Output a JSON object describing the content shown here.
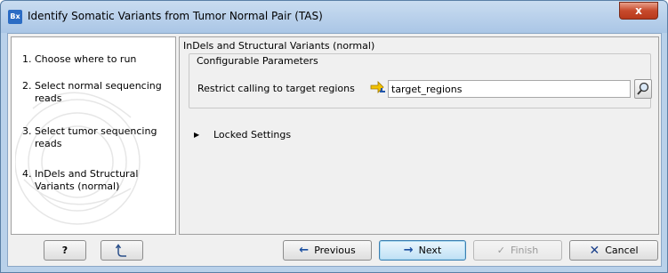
{
  "window": {
    "app_icon_text": "Bx",
    "title": "Identify Somatic Variants from Tumor Normal Pair (TAS)",
    "close_label": "x"
  },
  "steps": [
    {
      "num": "1.",
      "label": "Choose where to run"
    },
    {
      "num": "2.",
      "label": "Select normal sequencing reads"
    },
    {
      "num": "3.",
      "label": "Select tumor sequencing reads"
    },
    {
      "num": "4.",
      "label": "InDels and Structural Variants (normal)"
    }
  ],
  "panel": {
    "title": "InDels and Structural Variants (normal)",
    "group_title": "Configurable Parameters",
    "param_label": "Restrict calling to target regions",
    "target_value": "target_regions",
    "locked_label": "Locked Settings"
  },
  "buttons": {
    "help": "?",
    "previous": "Previous",
    "next": "Next",
    "finish": "Finish",
    "cancel": "Cancel"
  }
}
